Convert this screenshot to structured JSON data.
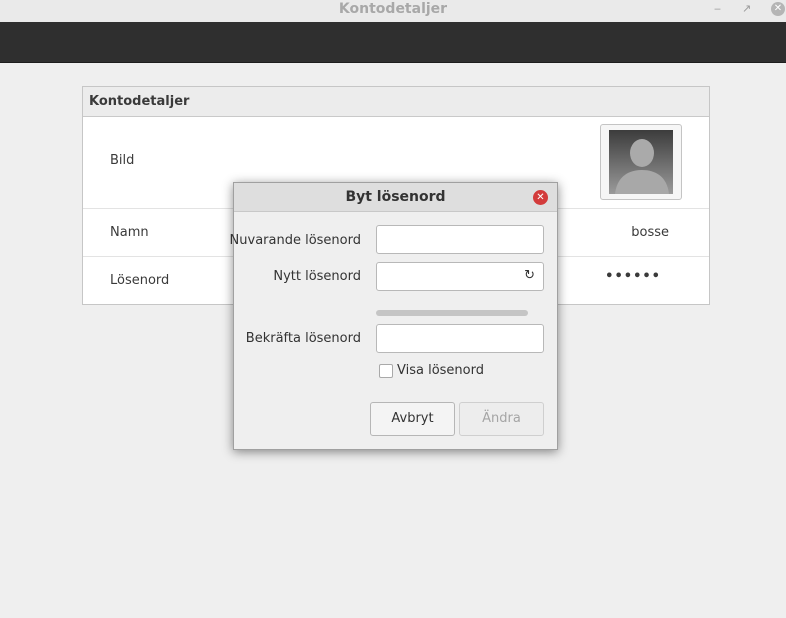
{
  "window": {
    "title": "Kontodetaljer",
    "min_glyph": "‒",
    "max_glyph": "↗",
    "close_glyph": "✕"
  },
  "panel": {
    "heading": "Kontodetaljer",
    "rows": [
      {
        "label": "Bild"
      },
      {
        "label": "Namn",
        "value": "bosse"
      },
      {
        "label": "Lösenord",
        "value": "••••••"
      }
    ]
  },
  "dialog": {
    "title": "Byt lösenord",
    "close_glyph": "✕",
    "current_label": "Nuvarande lösenord",
    "new_label": "Nytt lösenord",
    "confirm_label": "Bekräfta lösenord",
    "show_password_label": "Visa lösenord",
    "generate_icon_glyph": "↻",
    "cancel_label": "Avbryt",
    "ok_label": "Ändra",
    "show_password_checked": false,
    "strength_level": 0
  },
  "icons": [
    "minimize-icon",
    "maximize-icon",
    "close-icon",
    "avatar-icon",
    "generate-password-icon"
  ]
}
